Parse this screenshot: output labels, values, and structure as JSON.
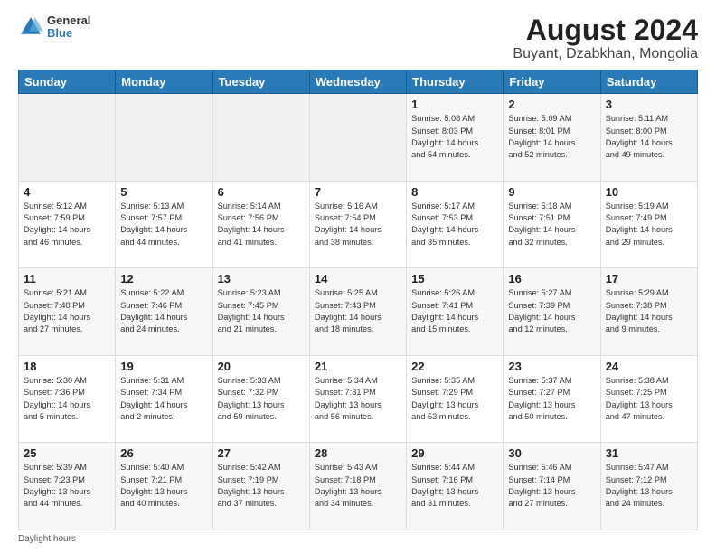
{
  "header": {
    "title": "August 2024",
    "subtitle": "Buyant, Dzabkhan, Mongolia",
    "logo_line1": "General",
    "logo_line2": "Blue"
  },
  "days_of_week": [
    "Sunday",
    "Monday",
    "Tuesday",
    "Wednesday",
    "Thursday",
    "Friday",
    "Saturday"
  ],
  "weeks": [
    [
      {
        "day": "",
        "info": ""
      },
      {
        "day": "",
        "info": ""
      },
      {
        "day": "",
        "info": ""
      },
      {
        "day": "",
        "info": ""
      },
      {
        "day": "1",
        "info": "Sunrise: 5:08 AM\nSunset: 8:03 PM\nDaylight: 14 hours\nand 54 minutes."
      },
      {
        "day": "2",
        "info": "Sunrise: 5:09 AM\nSunset: 8:01 PM\nDaylight: 14 hours\nand 52 minutes."
      },
      {
        "day": "3",
        "info": "Sunrise: 5:11 AM\nSunset: 8:00 PM\nDaylight: 14 hours\nand 49 minutes."
      }
    ],
    [
      {
        "day": "4",
        "info": "Sunrise: 5:12 AM\nSunset: 7:59 PM\nDaylight: 14 hours\nand 46 minutes."
      },
      {
        "day": "5",
        "info": "Sunrise: 5:13 AM\nSunset: 7:57 PM\nDaylight: 14 hours\nand 44 minutes."
      },
      {
        "day": "6",
        "info": "Sunrise: 5:14 AM\nSunset: 7:56 PM\nDaylight: 14 hours\nand 41 minutes."
      },
      {
        "day": "7",
        "info": "Sunrise: 5:16 AM\nSunset: 7:54 PM\nDaylight: 14 hours\nand 38 minutes."
      },
      {
        "day": "8",
        "info": "Sunrise: 5:17 AM\nSunset: 7:53 PM\nDaylight: 14 hours\nand 35 minutes."
      },
      {
        "day": "9",
        "info": "Sunrise: 5:18 AM\nSunset: 7:51 PM\nDaylight: 14 hours\nand 32 minutes."
      },
      {
        "day": "10",
        "info": "Sunrise: 5:19 AM\nSunset: 7:49 PM\nDaylight: 14 hours\nand 29 minutes."
      }
    ],
    [
      {
        "day": "11",
        "info": "Sunrise: 5:21 AM\nSunset: 7:48 PM\nDaylight: 14 hours\nand 27 minutes."
      },
      {
        "day": "12",
        "info": "Sunrise: 5:22 AM\nSunset: 7:46 PM\nDaylight: 14 hours\nand 24 minutes."
      },
      {
        "day": "13",
        "info": "Sunrise: 5:23 AM\nSunset: 7:45 PM\nDaylight: 14 hours\nand 21 minutes."
      },
      {
        "day": "14",
        "info": "Sunrise: 5:25 AM\nSunset: 7:43 PM\nDaylight: 14 hours\nand 18 minutes."
      },
      {
        "day": "15",
        "info": "Sunrise: 5:26 AM\nSunset: 7:41 PM\nDaylight: 14 hours\nand 15 minutes."
      },
      {
        "day": "16",
        "info": "Sunrise: 5:27 AM\nSunset: 7:39 PM\nDaylight: 14 hours\nand 12 minutes."
      },
      {
        "day": "17",
        "info": "Sunrise: 5:29 AM\nSunset: 7:38 PM\nDaylight: 14 hours\nand 9 minutes."
      }
    ],
    [
      {
        "day": "18",
        "info": "Sunrise: 5:30 AM\nSunset: 7:36 PM\nDaylight: 14 hours\nand 5 minutes."
      },
      {
        "day": "19",
        "info": "Sunrise: 5:31 AM\nSunset: 7:34 PM\nDaylight: 14 hours\nand 2 minutes."
      },
      {
        "day": "20",
        "info": "Sunrise: 5:33 AM\nSunset: 7:32 PM\nDaylight: 13 hours\nand 59 minutes."
      },
      {
        "day": "21",
        "info": "Sunrise: 5:34 AM\nSunset: 7:31 PM\nDaylight: 13 hours\nand 56 minutes."
      },
      {
        "day": "22",
        "info": "Sunrise: 5:35 AM\nSunset: 7:29 PM\nDaylight: 13 hours\nand 53 minutes."
      },
      {
        "day": "23",
        "info": "Sunrise: 5:37 AM\nSunset: 7:27 PM\nDaylight: 13 hours\nand 50 minutes."
      },
      {
        "day": "24",
        "info": "Sunrise: 5:38 AM\nSunset: 7:25 PM\nDaylight: 13 hours\nand 47 minutes."
      }
    ],
    [
      {
        "day": "25",
        "info": "Sunrise: 5:39 AM\nSunset: 7:23 PM\nDaylight: 13 hours\nand 44 minutes."
      },
      {
        "day": "26",
        "info": "Sunrise: 5:40 AM\nSunset: 7:21 PM\nDaylight: 13 hours\nand 40 minutes."
      },
      {
        "day": "27",
        "info": "Sunrise: 5:42 AM\nSunset: 7:19 PM\nDaylight: 13 hours\nand 37 minutes."
      },
      {
        "day": "28",
        "info": "Sunrise: 5:43 AM\nSunset: 7:18 PM\nDaylight: 13 hours\nand 34 minutes."
      },
      {
        "day": "29",
        "info": "Sunrise: 5:44 AM\nSunset: 7:16 PM\nDaylight: 13 hours\nand 31 minutes."
      },
      {
        "day": "30",
        "info": "Sunrise: 5:46 AM\nSunset: 7:14 PM\nDaylight: 13 hours\nand 27 minutes."
      },
      {
        "day": "31",
        "info": "Sunrise: 5:47 AM\nSunset: 7:12 PM\nDaylight: 13 hours\nand 24 minutes."
      }
    ]
  ],
  "footer": {
    "daylight_label": "Daylight hours"
  }
}
